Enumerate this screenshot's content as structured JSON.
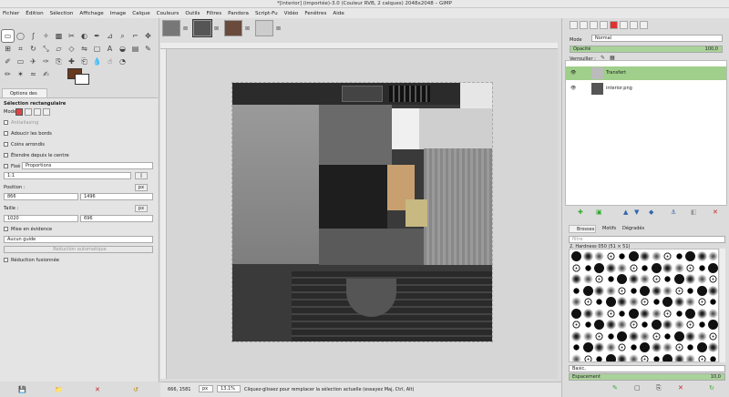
{
  "window": {
    "title": "*[interior] (importée)-3.0 (Couleur RVB, 2 calques) 2048x2048 – GIMP"
  },
  "menu": [
    "Fichier",
    "Édition",
    "Sélection",
    "Affichage",
    "Image",
    "Calque",
    "Couleurs",
    "Outils",
    "Filtres",
    "Pandora",
    "Script-Fu",
    "Vidéo",
    "Fenêtres",
    "Aide"
  ],
  "toolbox": {
    "fg_color": "#6a3a1e",
    "bg_color": "#ffffff",
    "tab_label": "Options des outils"
  },
  "tool_options": {
    "title": "Sélection rectangulaire",
    "mode_label": "Mode :",
    "antialias": "Antialiasing",
    "feather": "Adoucir les bords",
    "rounded": "Coins arrondis",
    "expand_center": "Étendre depuis le centre",
    "fixed_label": "Fixé",
    "fixed_value": "Proportions",
    "ratio": "1:1",
    "position_label": "Position :",
    "position_unit": "px",
    "position_x": "866",
    "position_y": "1496",
    "size_label": "Taille :",
    "size_unit": "px",
    "size_w": "1020",
    "size_h": "696",
    "highlight": "Mise en évidence",
    "guides": "Aucun guide",
    "auto_shrink": "Réduction automatique",
    "shrink_merged": "Réduction fusionnée"
  },
  "status": {
    "coords": "666, 1581",
    "unit": "px",
    "zoom": "13,1%",
    "message": "Cliquez-glissez pour remplacer la sélection actuelle (essayez Maj, Ctrl, Alt)"
  },
  "layers": {
    "mode_label": "Mode",
    "mode_value": "Normal",
    "opacity_label": "Opacité",
    "opacity_value": "100,0",
    "lock_label": "Verrouiller :",
    "items": [
      {
        "name": "Transfert"
      },
      {
        "name": "interior.png"
      }
    ]
  },
  "brushes": {
    "tabs": [
      "Brosses",
      "Motifs",
      "Dégradés"
    ],
    "filter_placeholder": "filtre",
    "current": "2. Hardness 050 (51 × 51)",
    "preset_label": "Basic,",
    "spacing_label": "Espacement",
    "spacing_value": "10,0"
  }
}
